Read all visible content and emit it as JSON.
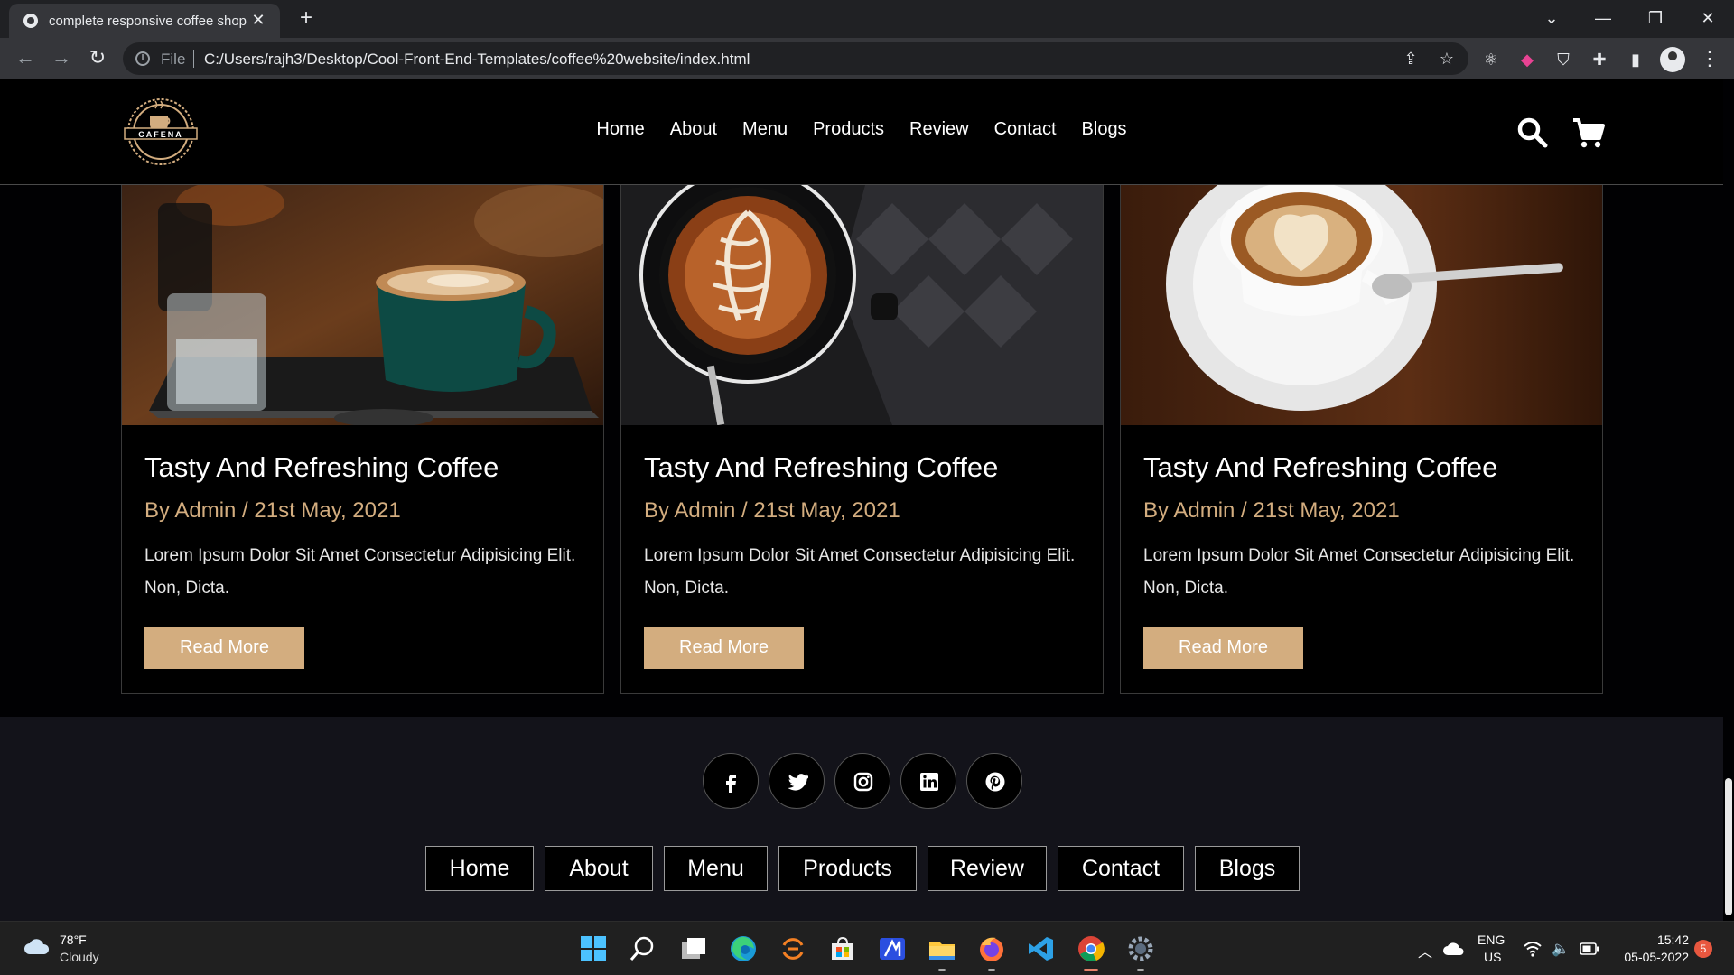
{
  "browser": {
    "tab_title": "complete responsive coffee shop",
    "close_symbol": "✕",
    "new_tab_symbol": "+",
    "file_label": "File",
    "url": "C:/Users/rajh3/Desktop/Cool-Front-End-Templates/coffee%20website/index.html"
  },
  "site": {
    "logo_text": "CAFENA",
    "nav": [
      "Home",
      "About",
      "Menu",
      "Products",
      "Review",
      "Contact",
      "Blogs"
    ]
  },
  "blogs": [
    {
      "title": "Tasty And Refreshing Coffee",
      "meta": "By Admin / 21st May, 2021",
      "text": "Lorem Ipsum Dolor Sit Amet Consectetur Adipisicing Elit. Non, Dicta.",
      "button": "Read More",
      "image": "latte-teal-cup-with-water-glass"
    },
    {
      "title": "Tasty And Refreshing Coffee",
      "meta": "By Admin / 21st May, 2021",
      "text": "Lorem Ipsum Dolor Sit Amet Consectetur Adipisicing Elit. Non, Dicta.",
      "button": "Read More",
      "image": "latte-art-black-cup-top-view"
    },
    {
      "title": "Tasty And Refreshing Coffee",
      "meta": "By Admin / 21st May, 2021",
      "text": "Lorem Ipsum Dolor Sit Amet Consectetur Adipisicing Elit. Non, Dicta.",
      "button": "Read More",
      "image": "cappuccino-white-cup-on-saucer"
    }
  ],
  "footer": {
    "social": [
      "facebook-icon",
      "twitter-icon",
      "instagram-icon",
      "linkedin-icon",
      "pinterest-icon"
    ],
    "links": [
      "Home",
      "About",
      "Menu",
      "Products",
      "Review",
      "Contact",
      "Blogs"
    ]
  },
  "taskbar": {
    "temperature": "78°F",
    "condition": "Cloudy",
    "lang_line1": "ENG",
    "lang_line2": "US",
    "time": "15:42",
    "date": "05-05-2022",
    "notification_count": "5"
  },
  "colors": {
    "accent": "#d3ad7f",
    "page_bg": "#010103",
    "footer_bg": "#13131a"
  }
}
